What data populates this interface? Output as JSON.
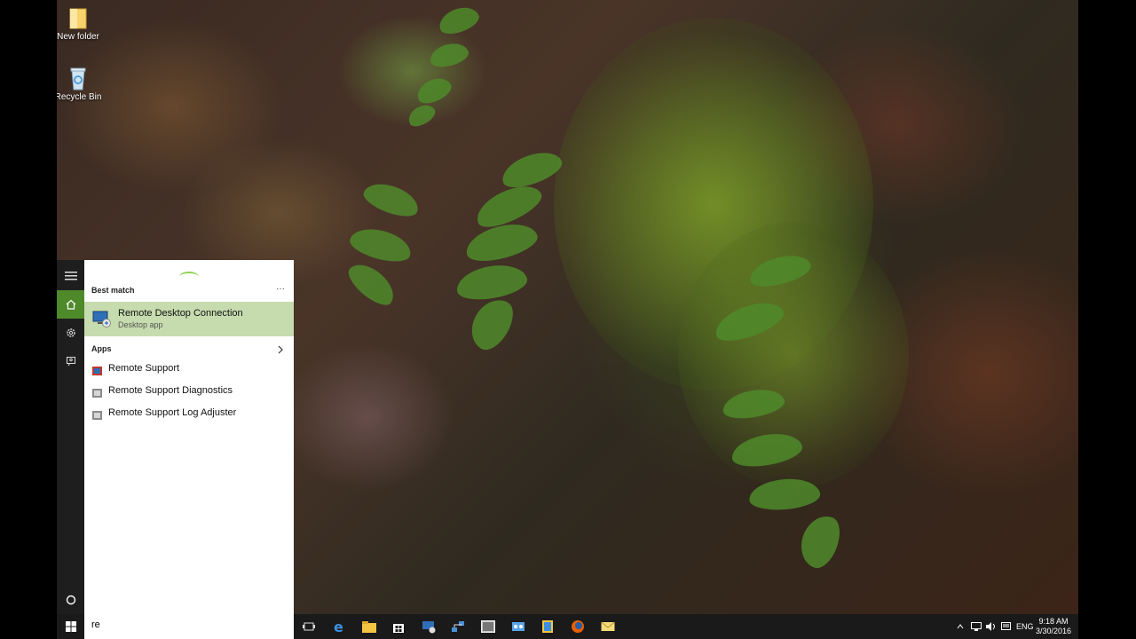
{
  "desktop": {
    "icons": [
      {
        "label": "New folder",
        "icon": "folder-icon"
      },
      {
        "label": "Recycle Bin",
        "icon": "recycle-bin-icon"
      }
    ]
  },
  "start_rail": {
    "items": [
      "hamburger-menu-icon",
      "home-icon",
      "settings-icon",
      "feedback-icon"
    ],
    "cortana_icon": "cortana-circle-icon"
  },
  "search_results": {
    "best_match_label": "Best match",
    "more_label": "···",
    "best_match": {
      "title": "Remote Desktop Connection",
      "subtitle": "Desktop app"
    },
    "apps_label": "Apps",
    "apps": [
      {
        "label": "Remote Support"
      },
      {
        "label": "Remote Support Diagnostics"
      },
      {
        "label": "Remote Support Log Adjuster"
      }
    ],
    "highlight_color": "#c6dbae"
  },
  "taskbar": {
    "search_value": "re",
    "pinned": [
      "task-view-icon",
      "edge-icon",
      "file-explorer-icon",
      "store-icon",
      "remote-desktop-icon",
      "network-icon",
      "photo-icon",
      "control-panel-icon",
      "library-icon",
      "firefox-icon",
      "mail-icon"
    ],
    "tray": {
      "language": "ENG",
      "time": "9:18 AM",
      "date": "3/30/2016"
    }
  }
}
